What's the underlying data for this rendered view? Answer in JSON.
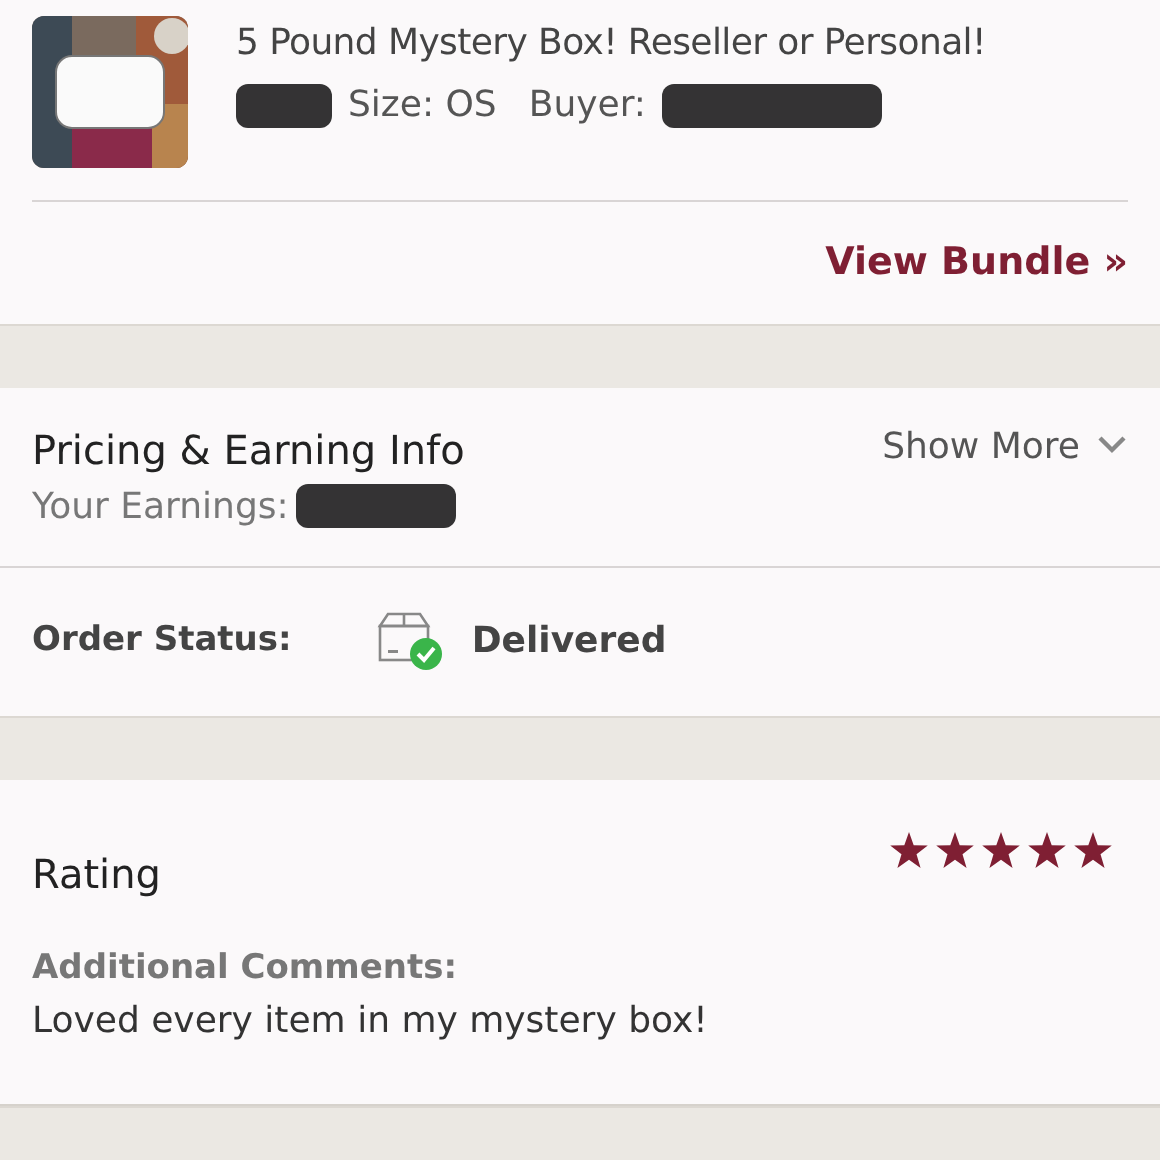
{
  "order_item": {
    "kind": "picture",
    "title": "5 Pound Mystery Box! Reseller or Personal!",
    "size": "Size: OS",
    "buyer_label": "Buyer:"
  },
  "bundle_link": {
    "label": "View Bundle »"
  },
  "pricing": {
    "title": "Pricing & Earning Info",
    "earnings_label": "Your Earnings:",
    "toggle": "Show More",
    "expanded": false
  },
  "order_status": {
    "label": "Order Status:",
    "value": "Delivered"
  },
  "rating": {
    "title": "Rating",
    "stars": 5,
    "comments_label": "Additional Comments:",
    "comment": "Loved every item in my mystery box!"
  }
}
